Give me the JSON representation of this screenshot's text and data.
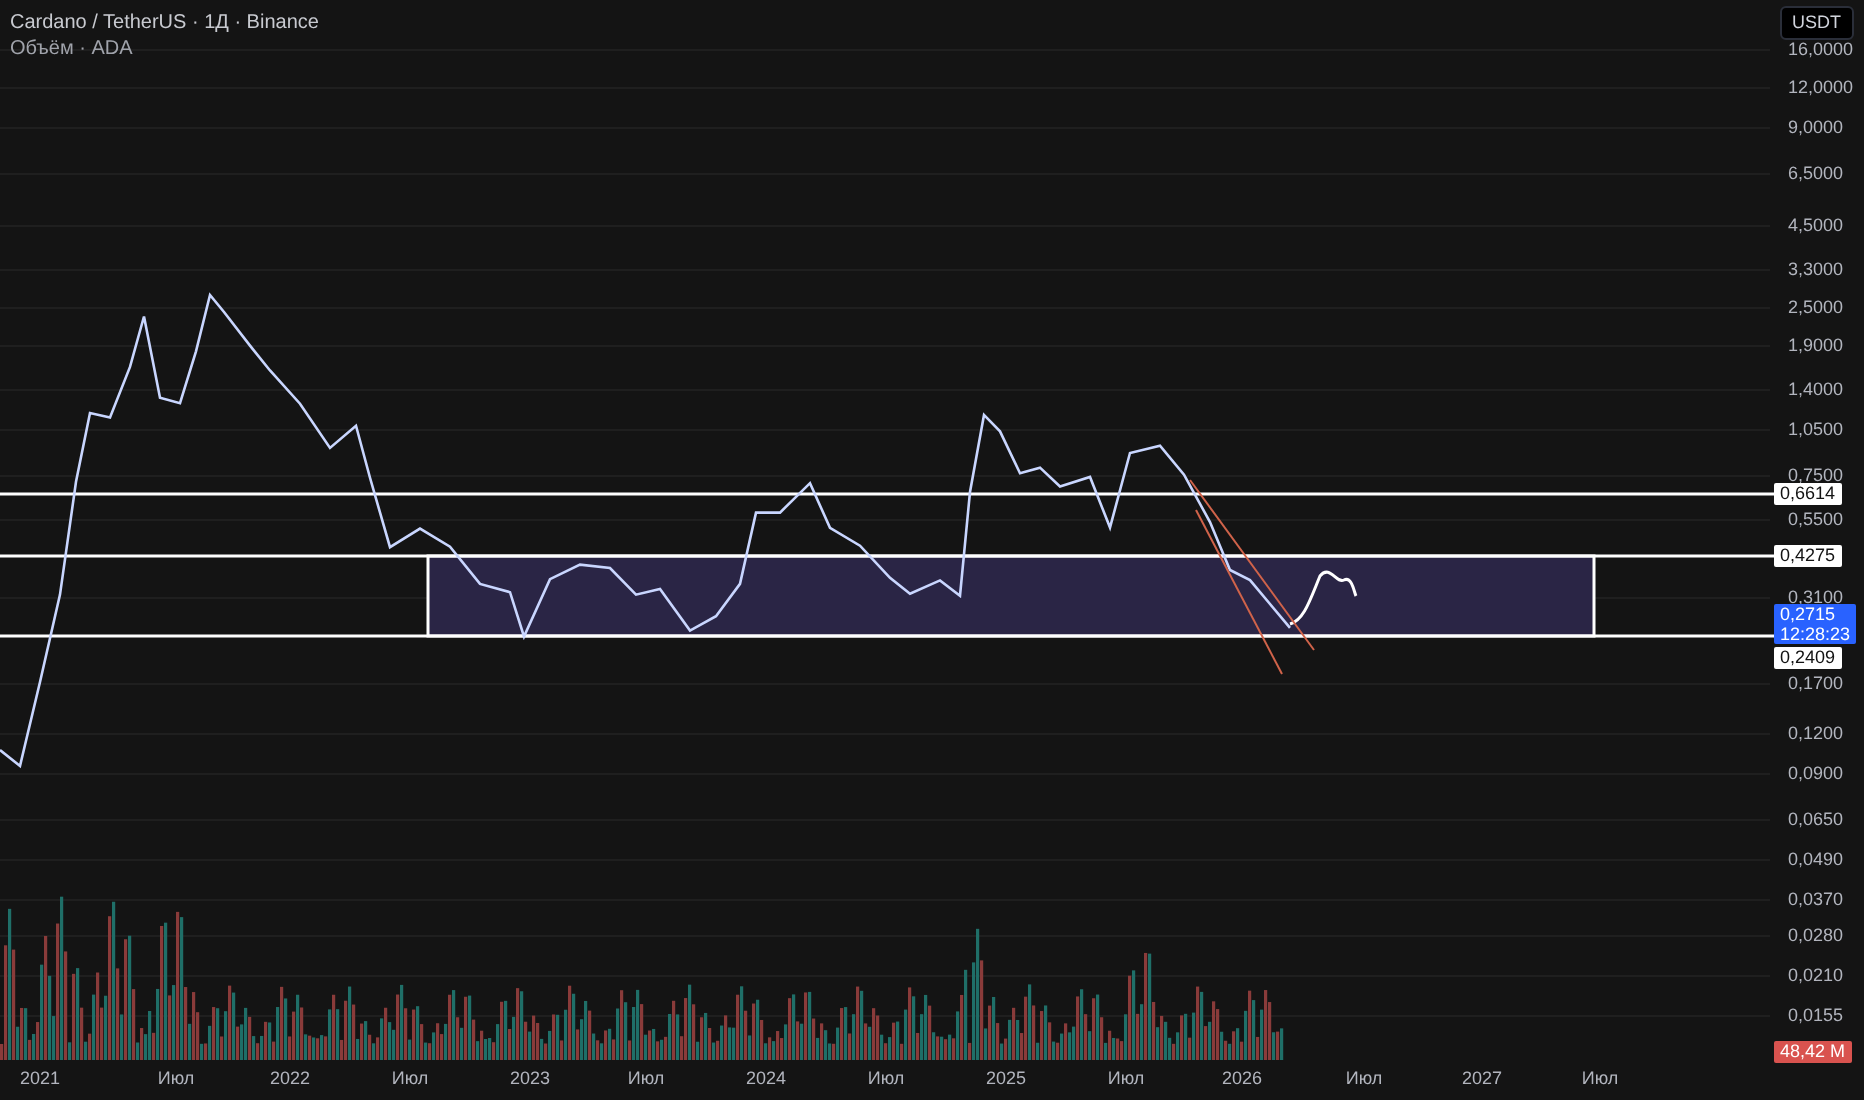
{
  "legend": {
    "title": "Cardano / TetherUS · 1Д · Binance",
    "subtitle": "Объём · ADA"
  },
  "currency_button": {
    "label": "USDT"
  },
  "price_axis": {
    "ticks": [
      "16,0000",
      "12,0000",
      "9,0000",
      "6,5000",
      "4,5000",
      "3,3000",
      "2,5000",
      "1,9000",
      "1,4000",
      "1,0500",
      "0,7500",
      "0,5500",
      "0,3100",
      "0,1700",
      "0,1200",
      "0,0900",
      "0,0650",
      "0,0490",
      "0,0370",
      "0,0280",
      "0,0210",
      "0,0155"
    ]
  },
  "price_labels": [
    {
      "kind": "level",
      "text": "0,6614"
    },
    {
      "kind": "level",
      "text": "0,4275"
    },
    {
      "kind": "current",
      "text": "0,2715",
      "countdown": "12:28:23"
    },
    {
      "kind": "level",
      "text": "0,2409"
    },
    {
      "kind": "volume",
      "text": "48,42 M"
    }
  ],
  "time_axis": {
    "labels": [
      "2021",
      "Июл",
      "2022",
      "Июл",
      "2023",
      "Июл",
      "2024",
      "Июл",
      "2025",
      "Июл",
      "2026",
      "Июл",
      "2027",
      "Июл"
    ]
  }
}
